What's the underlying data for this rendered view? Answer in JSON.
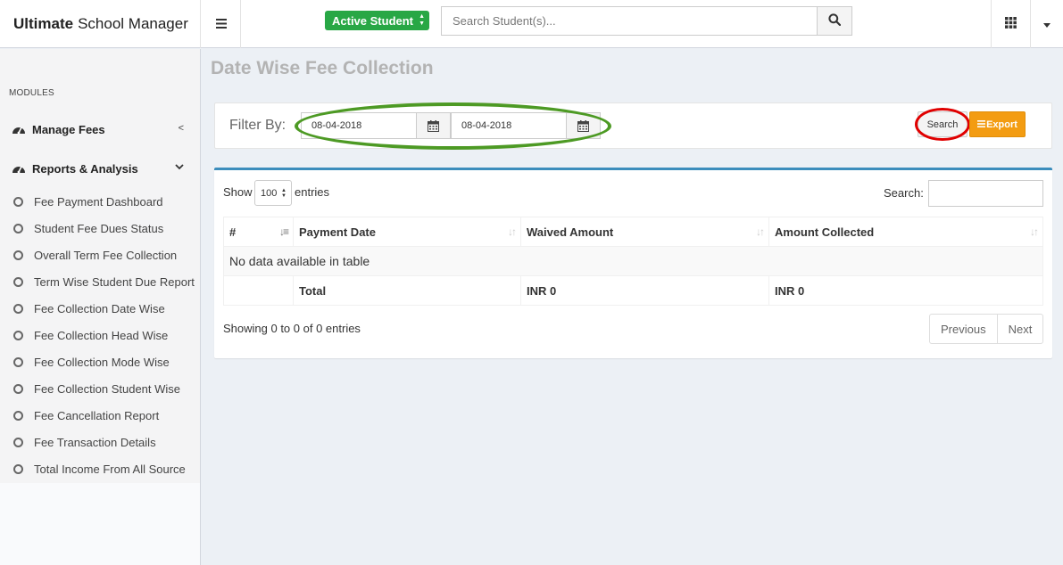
{
  "header": {
    "brand_bold": "Ultimate",
    "brand_rest": "School Manager",
    "active_student_label": "Active Student",
    "search_placeholder": "Search Student(s)..."
  },
  "sidebar": {
    "section_label": "MODULES",
    "menus": [
      {
        "label": "Manage Fees",
        "icon": "dashboard-icon",
        "expanded": false
      },
      {
        "label": "Reports & Analysis",
        "icon": "dashboard-icon",
        "expanded": true
      }
    ],
    "items": [
      {
        "label": "Fee Payment Dashboard"
      },
      {
        "label": "Student Fee Dues Status"
      },
      {
        "label": "Overall Term Fee Collection"
      },
      {
        "label": "Term Wise Student Due Report"
      },
      {
        "label": "Fee Collection Date Wise"
      },
      {
        "label": "Fee Collection Head Wise"
      },
      {
        "label": "Fee Collection Mode Wise"
      },
      {
        "label": "Fee Collection Student Wise"
      },
      {
        "label": "Fee Cancellation Report"
      },
      {
        "label": "Fee Transaction Details"
      },
      {
        "label": "Total Income From All Source"
      }
    ]
  },
  "page": {
    "title": "Date Wise Fee Collection"
  },
  "filter": {
    "label": "Filter By:",
    "from_date": "08-04-2018",
    "to_date": "08-04-2018",
    "search_button": "Search",
    "export_button": "Export"
  },
  "table": {
    "show_label": "Show",
    "entries_value": "100",
    "entries_label": "entries",
    "search_label": "Search:",
    "columns": [
      "#",
      "Payment Date",
      "Waived Amount",
      "Amount Collected"
    ],
    "empty_message": "No data available in table",
    "footer": {
      "label": "Total",
      "waived": "INR 0",
      "collected": "INR 0"
    },
    "info": "Showing 0 to 0 of 0 entries",
    "previous": "Previous",
    "next": "Next"
  },
  "colors": {
    "accent_blue": "#3c8dbc",
    "active_green": "#28a745",
    "export_orange": "#f39c12",
    "highlight_green": "#4d9a24",
    "highlight_red": "#e00000"
  }
}
